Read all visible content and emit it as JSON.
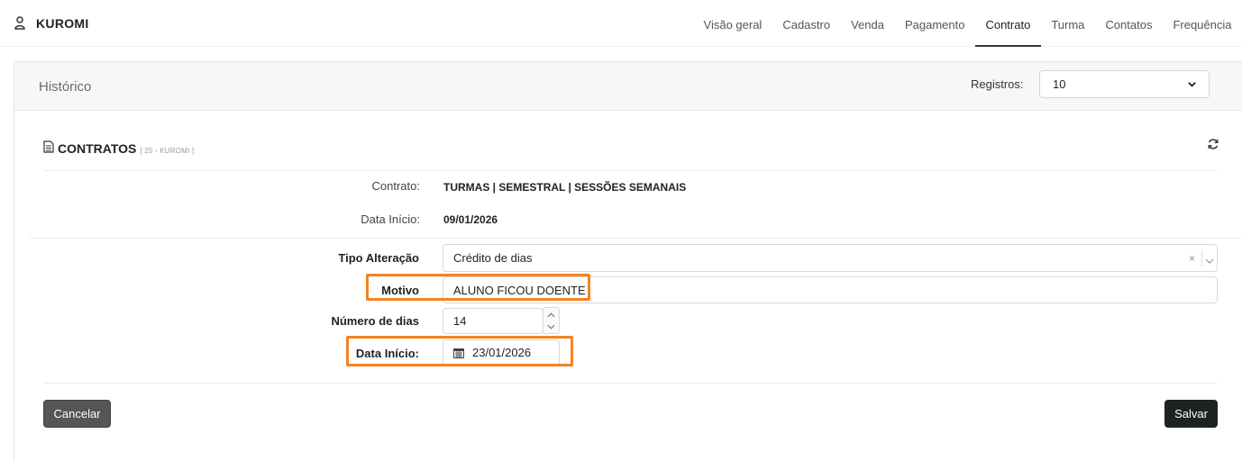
{
  "app": {
    "name": "KUROMI",
    "user_icon": "person-icon"
  },
  "nav": {
    "tabs": [
      {
        "label": "Visão geral",
        "active": false
      },
      {
        "label": "Cadastro",
        "active": false
      },
      {
        "label": "Venda",
        "active": false
      },
      {
        "label": "Pagamento",
        "active": false
      },
      {
        "label": "Contrato",
        "active": true
      },
      {
        "label": "Turma",
        "active": false
      },
      {
        "label": "Contatos",
        "active": false
      },
      {
        "label": "Frequência",
        "active": false
      }
    ]
  },
  "historico": {
    "title": "Histórico",
    "registros_label": "Registros:",
    "registros_value": "10"
  },
  "contratos": {
    "title": "CONTRATOS",
    "subtitle": "[ 25 - KUROMI ]",
    "contrato_label": "Contrato:",
    "contrato_value": "TURMAS | SEMESTRAL | SESSÕES SEMANAIS",
    "data_inicio_label": "Data Início:",
    "data_inicio_value": "09/01/2026"
  },
  "form": {
    "tipo_label": "Tipo Alteração",
    "tipo_value": "Crédito de dias",
    "tipo_clear": "×",
    "motivo_label": "Motivo",
    "motivo_value": "ALUNO FICOU DOENTE",
    "numero_label": "Número de dias",
    "numero_value": "14",
    "data_label": "Data Início:",
    "data_value": "23/01/2026"
  },
  "actions": {
    "cancel_label": "Cancelar",
    "save_label": "Salvar"
  },
  "colors": {
    "highlight": "#f5831f",
    "save_button": "#1f231f",
    "cancel_button": "#555555"
  }
}
